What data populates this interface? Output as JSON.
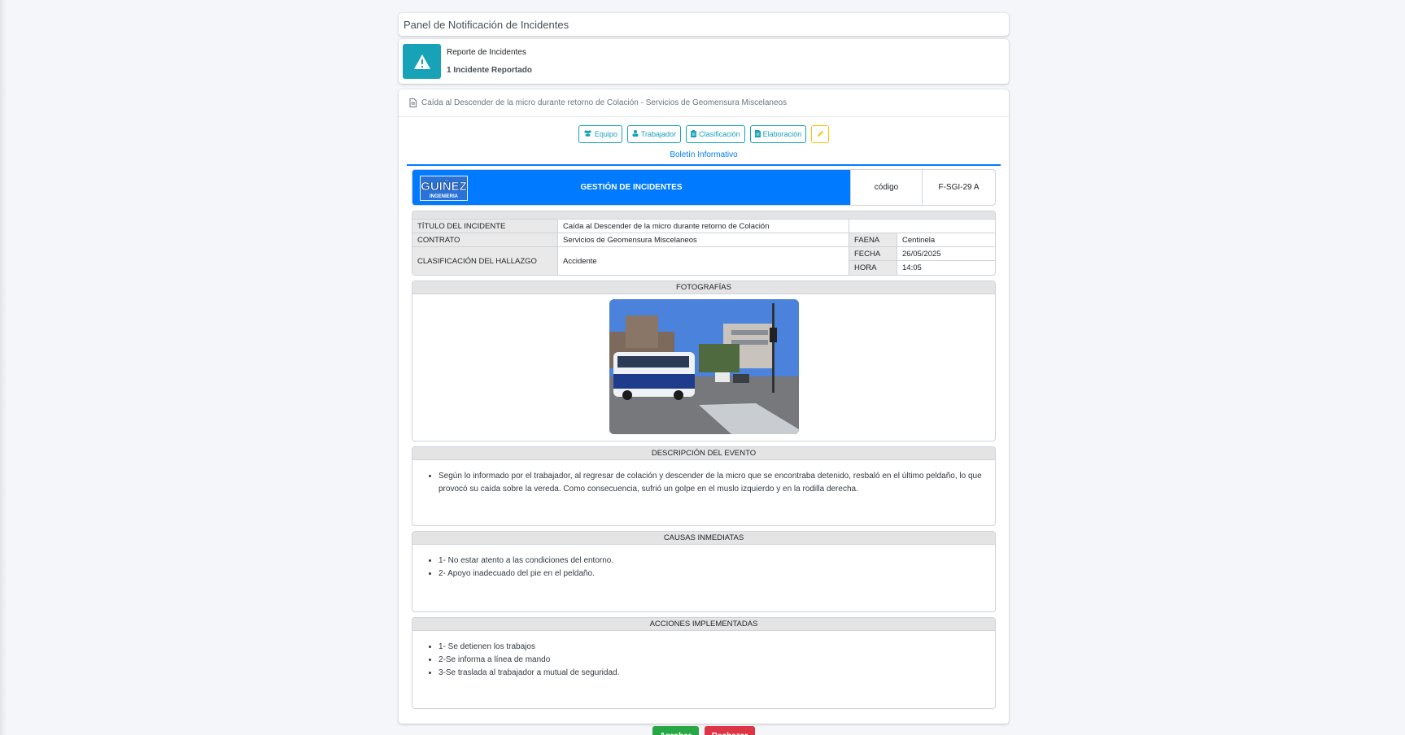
{
  "panel": {
    "title": "Panel de Notificación de Incidentes"
  },
  "summary": {
    "label": "Reporte de Incidentes",
    "count_text": "1 Incidente Reportado",
    "icon": "warning-icon"
  },
  "incident": {
    "header": "Caída al Descender de la micro durante retorno de Colación - Servicios de Geomensura Miscelaneos",
    "buttons": [
      {
        "label": "Equipo",
        "icon": "users-icon"
      },
      {
        "label": "Trabajador",
        "icon": "user-icon"
      },
      {
        "label": "Clasificación",
        "icon": "clipboard-icon"
      },
      {
        "label": "Elaboración",
        "icon": "file-icon"
      }
    ],
    "tab": "Boletín Informativo"
  },
  "doc": {
    "logo_top": "GUIÑEZ",
    "logo_bottom": "INGENIERIA",
    "title": "GESTIÓN DE INCIDENTES",
    "code_label": "código",
    "code_value": "F-SGI-29 A",
    "fields": {
      "titulo_label": "TÍTULO DEL INCIDENTE",
      "titulo_value": "Caída al Descender de la micro durante retorno de Colación",
      "contrato_label": "CONTRATO",
      "contrato_value": "Servicios de Geomensura Miscelaneos",
      "clasificacion_label": "CLASIFICACIÓN DEL HALLAZGO",
      "clasificacion_value": "Accidente",
      "faena_label": "FAENA",
      "faena_value": "Centinela",
      "fecha_label": "FECHA",
      "fecha_value": "26/05/2025",
      "hora_label": "HORA",
      "hora_value": "14:05"
    },
    "fotografias_title": "FOTOGRAFÍAS",
    "descripcion_title": "DESCRIPCIÓN DEL EVENTO",
    "descripcion_items": [
      "Según lo informado por el trabajador, al regresar de colación y descender de la micro que se encontraba detenido, resbaló en el último peldaño, lo que provocó su caída sobre la vereda. Como consecuencia, sufrió un golpe en el muslo izquierdo y en la rodilla derecha."
    ],
    "causas_title": "CAUSAS INMEDIATAS",
    "causas_items": [
      "1- No estar atento a las condiciones del entorno.",
      "2- Apoyo inadecuado del pie en el peldaño."
    ],
    "acciones_title": "ACCIONES IMPLEMENTADAS",
    "acciones_items": [
      "1- Se detienen los trabajos",
      "2-Se informa a línea de mando",
      "3-Se traslada al trabajador a mutual de seguridad."
    ]
  },
  "actions": {
    "approve": "Aprobar",
    "reject": "Rechazar"
  },
  "colors": {
    "primary": "#007bff",
    "info": "#17a2b8",
    "success": "#28a745",
    "danger": "#dc3545",
    "warning": "#ffc107"
  }
}
